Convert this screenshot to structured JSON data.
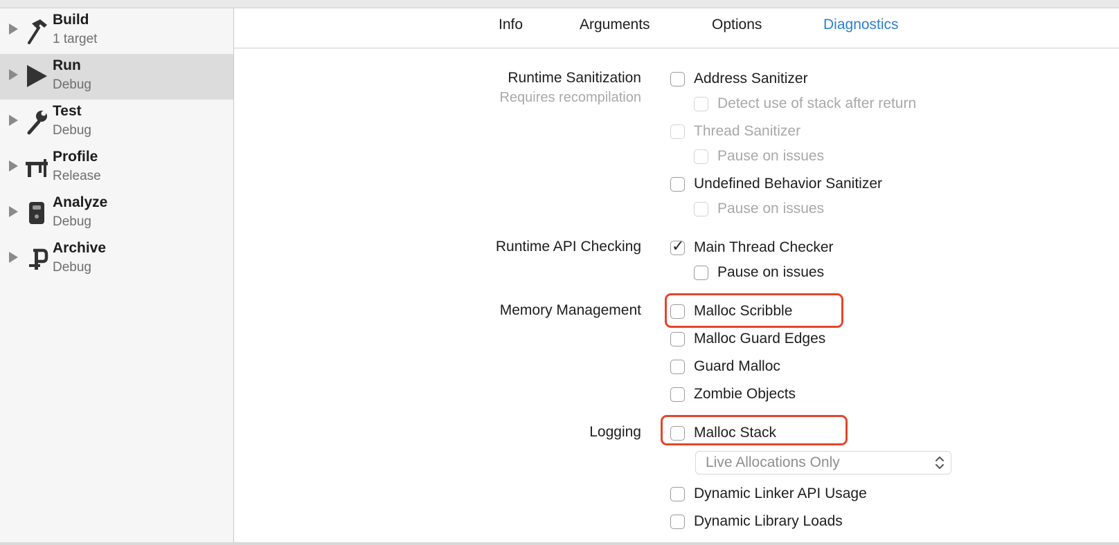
{
  "sidebar": {
    "items": [
      {
        "title": "Build",
        "subtitle": "1 target",
        "icon": "hammer-icon",
        "selected": false
      },
      {
        "title": "Run",
        "subtitle": "Debug",
        "icon": "play-icon",
        "selected": true
      },
      {
        "title": "Test",
        "subtitle": "Debug",
        "icon": "wrench-icon",
        "selected": false
      },
      {
        "title": "Profile",
        "subtitle": "Release",
        "icon": "caliper-icon",
        "selected": false
      },
      {
        "title": "Analyze",
        "subtitle": "Debug",
        "icon": "analyze-icon",
        "selected": false
      },
      {
        "title": "Archive",
        "subtitle": "Debug",
        "icon": "archive-icon",
        "selected": false
      }
    ]
  },
  "tabs": [
    {
      "label": "Info",
      "active": false
    },
    {
      "label": "Arguments",
      "active": false
    },
    {
      "label": "Options",
      "active": false
    },
    {
      "label": "Diagnostics",
      "active": true
    }
  ],
  "sections": {
    "runtime_sanitization": {
      "label": "Runtime Sanitization",
      "hint": "Requires recompilation",
      "options": [
        {
          "label": "Address Sanitizer",
          "checked": false,
          "enabled": true
        },
        {
          "label": "Detect use of stack after return",
          "checked": false,
          "enabled": false
        },
        {
          "label": "Thread Sanitizer",
          "checked": false,
          "enabled": false
        },
        {
          "label": "Pause on issues",
          "checked": false,
          "enabled": false
        },
        {
          "label": "Undefined Behavior Sanitizer",
          "checked": false,
          "enabled": true
        },
        {
          "label": "Pause on issues",
          "checked": false,
          "enabled": false
        }
      ]
    },
    "runtime_api_checking": {
      "label": "Runtime API Checking",
      "options": [
        {
          "label": "Main Thread Checker",
          "checked": true,
          "enabled": true
        },
        {
          "label": "Pause on issues",
          "checked": false,
          "enabled": true
        }
      ]
    },
    "memory_management": {
      "label": "Memory Management",
      "options": [
        {
          "label": "Malloc Scribble",
          "checked": false,
          "enabled": true
        },
        {
          "label": "Malloc Guard Edges",
          "checked": false,
          "enabled": true
        },
        {
          "label": "Guard Malloc",
          "checked": false,
          "enabled": true
        },
        {
          "label": "Zombie Objects",
          "checked": false,
          "enabled": true
        }
      ]
    },
    "logging": {
      "label": "Logging",
      "options": [
        {
          "label": "Malloc Stack",
          "checked": false,
          "enabled": true
        },
        {
          "label": "Dynamic Linker API Usage",
          "checked": false,
          "enabled": true
        },
        {
          "label": "Dynamic Library Loads",
          "checked": false,
          "enabled": true
        }
      ],
      "malloc_stack_mode": "Live Allocations Only"
    }
  },
  "colors": {
    "active_tab": "#2a7fd1",
    "annotation": "#e5452b",
    "selected_row": "#dcdcdc"
  }
}
